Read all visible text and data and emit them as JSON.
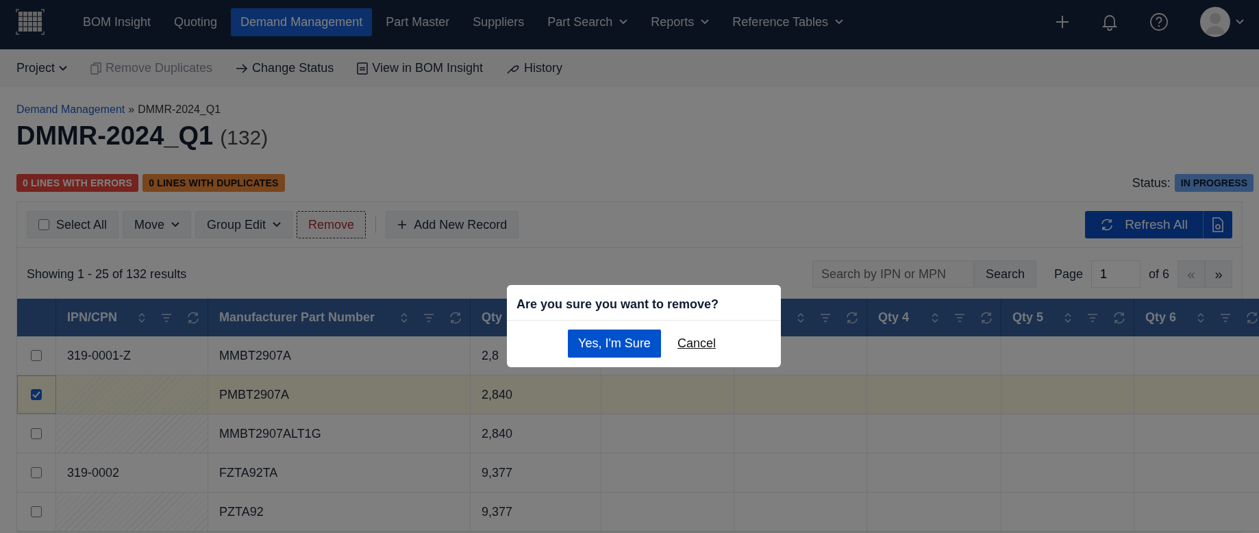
{
  "nav": {
    "items": [
      {
        "label": "BOM Insight",
        "selected": false,
        "dropdown": false
      },
      {
        "label": "Quoting",
        "selected": false,
        "dropdown": false
      },
      {
        "label": "Demand Management",
        "selected": true,
        "dropdown": false
      },
      {
        "label": "Part Master",
        "selected": false,
        "dropdown": false
      },
      {
        "label": "Suppliers",
        "selected": false,
        "dropdown": false
      },
      {
        "label": "Part Search",
        "selected": false,
        "dropdown": true
      },
      {
        "label": "Reports",
        "selected": false,
        "dropdown": true
      },
      {
        "label": "Reference Tables",
        "selected": false,
        "dropdown": true
      }
    ]
  },
  "subnav": {
    "items": [
      {
        "label": "Project",
        "disabled": false,
        "dropdown": true
      },
      {
        "label": "Remove Duplicates",
        "disabled": true,
        "dropdown": false
      },
      {
        "label": "Change Status",
        "disabled": false,
        "dropdown": false
      },
      {
        "label": "View in BOM Insight",
        "disabled": false,
        "dropdown": false
      },
      {
        "label": "History",
        "disabled": false,
        "dropdown": false
      }
    ]
  },
  "breadcrumb": {
    "link": "Demand Management",
    "separator": "»",
    "current": "DMMR-2024_Q1"
  },
  "title": "DMMR-2024_Q1",
  "count": "(132)",
  "badges": [
    {
      "label": "0 LINES WITH ERRORS",
      "kind": "error"
    },
    {
      "label": "0 LINES WITH DUPLICATES",
      "kind": "duplicate"
    }
  ],
  "status": {
    "label": "Status:",
    "value": "IN PROGRESS"
  },
  "actions": {
    "select_all": {
      "label": "Select All",
      "checked": false
    },
    "buttons": [
      {
        "label": "Move",
        "kind": "dropdown"
      },
      {
        "label": "Group Edit",
        "kind": "dropdown"
      },
      {
        "label": "Remove",
        "kind": "danger"
      },
      {
        "label": "Add New Record",
        "kind": "add"
      }
    ],
    "refresh": "Refresh All"
  },
  "results": {
    "summary": "Showing 1 - 25 of 132 results",
    "search_placeholder": "Search by IPN or MPN",
    "search_button": "Search",
    "page_label": "Page",
    "page_value": "1",
    "page_of": "of 6",
    "prev": "«",
    "next": "»"
  },
  "table": {
    "columns": [
      {
        "label": "IPN/CPN"
      },
      {
        "label": "Manufacturer Part Number"
      },
      {
        "label": "Qty"
      },
      {},
      {},
      {
        "label": "Qty 4"
      },
      {
        "label": "Qty 5"
      },
      {
        "label": "Qty 6"
      }
    ],
    "rows": [
      {
        "checked": false,
        "ipn": "319-0001-Z",
        "mpn": "MMBT2907A",
        "qty_1": "2,8"
      },
      {
        "checked": true,
        "mpn": "PMBT2907A",
        "qty_1": "2,840"
      },
      {
        "checked": false,
        "mpn": "MMBT2907ALT1G",
        "qty_1": "2,840"
      },
      {
        "checked": false,
        "ipn": "319-0002",
        "mpn": "FZTA92TA",
        "qty_1": "9,377"
      },
      {
        "checked": false,
        "mpn": "PZTA92",
        "qty_1": "9,377"
      }
    ]
  },
  "dialog": {
    "question": "Are you sure you want to remove?",
    "confirm": "Yes, I'm Sure",
    "cancel": "Cancel"
  }
}
